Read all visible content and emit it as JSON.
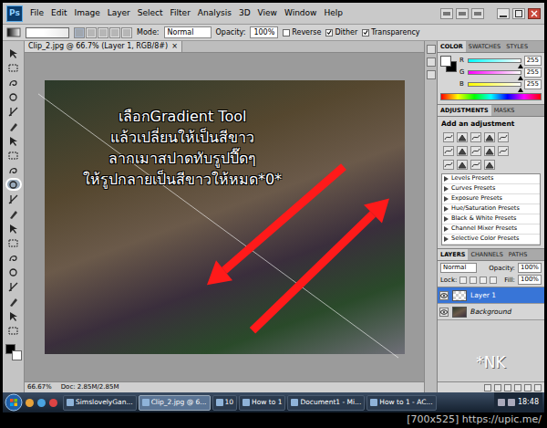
{
  "app_bar": {
    "logo": "Ps",
    "menu": [
      "File",
      "Edit",
      "Image",
      "Layer",
      "Select",
      "Filter",
      "Analysis",
      "3D",
      "View",
      "Window",
      "Help"
    ]
  },
  "options_bar": {
    "mode_label": "Mode:",
    "mode": "Normal",
    "opacity_label": "Opacity:",
    "opacity": "100%",
    "checkboxes": [
      {
        "label": "Reverse",
        "checked": false
      },
      {
        "label": "Dither",
        "checked": true
      },
      {
        "label": "Transparency",
        "checked": true
      }
    ]
  },
  "document_tab": {
    "title": "Clip_2.jpg @ 66.7% (Layer 1, RGB/8#)",
    "close": "×"
  },
  "annotations": {
    "lines": [
      "เลือกGradient Tool",
      "แล้วเปลี่ยนให้เป็นสีขาว",
      "ลากเมาสปาดทับรูปปี๊ดๆ",
      "ให้รูปกลายเป็นสีขาวให้หมด*0*"
    ],
    "signature": "*NK",
    "circled_tool_index": 9
  },
  "color_panel": {
    "tabs": [
      {
        "label": "COLOR",
        "selected": true
      },
      {
        "label": "SWATCHES",
        "selected": false
      },
      {
        "label": "STYLES",
        "selected": false
      }
    ],
    "sliders": [
      {
        "channel": "R",
        "value": "255",
        "level": 1,
        "color": "#00ffff"
      },
      {
        "channel": "G",
        "value": "255",
        "level": 1,
        "color": "#ff00ff"
      },
      {
        "channel": "B",
        "value": "255",
        "level": 1,
        "color": "#ffff00"
      }
    ]
  },
  "adjustments_panel": {
    "tabs": [
      {
        "label": "ADJUSTMENTS",
        "selected": true
      },
      {
        "label": "MASKS",
        "selected": false
      }
    ],
    "heading": "Add an adjustment",
    "presets": [
      "Levels Presets",
      "Curves Presets",
      "Exposure Presets",
      "Hue/Saturation Presets",
      "Black & White Presets",
      "Channel Mixer Presets",
      "Selective Color Presets"
    ]
  },
  "layers_panel": {
    "tabs": [
      {
        "label": "LAYERS",
        "selected": true
      },
      {
        "label": "CHANNELS",
        "selected": false
      },
      {
        "label": "PATHS",
        "selected": false
      }
    ],
    "blend_mode": "Normal",
    "opacity_label": "Opacity:",
    "opacity": "100%",
    "lock_label": "Lock:",
    "fill_label": "Fill:",
    "fill": "100%",
    "layers": [
      {
        "name": "Layer 1",
        "selected": true,
        "visible": true,
        "kind": "transparent"
      },
      {
        "name": "Background",
        "selected": false,
        "visible": true,
        "kind": "photo"
      }
    ]
  },
  "status_bar": {
    "zoom": "66.67%",
    "doc": "Doc: 2.85M/2.85M"
  },
  "taskbar": {
    "items": [
      {
        "label": "SimslovelyGan...",
        "selected": false
      },
      {
        "label": "Clip_2.jpg @ 6...",
        "selected": true
      },
      {
        "label": "10",
        "selected": false
      },
      {
        "label": "How to 1",
        "selected": false
      },
      {
        "label": "Document1 - Mi...",
        "selected": false
      },
      {
        "label": "How to 1 - AC...",
        "selected": false
      }
    ],
    "clock": "18:48"
  },
  "watermark": "[700x525] https://upic.me/"
}
